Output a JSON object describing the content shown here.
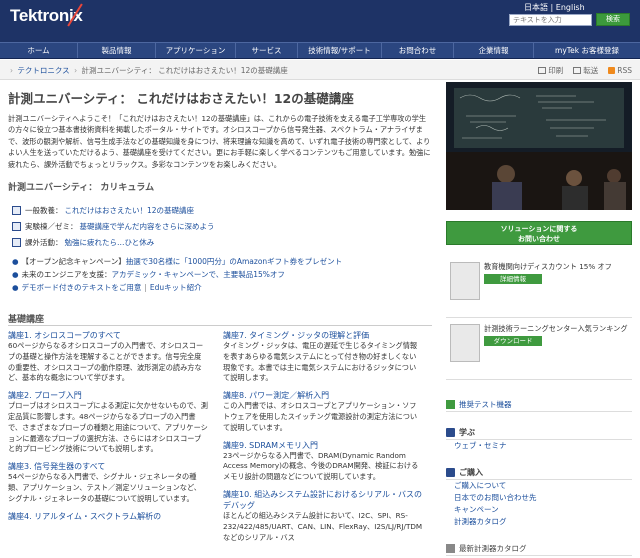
{
  "header": {
    "brand": "Tektronix",
    "language": "日本語 | English",
    "search_placeholder": "テキストを入力",
    "search_button": "検索"
  },
  "nav": [
    {
      "label": "ホーム",
      "width": 0
    },
    {
      "label": "製品情報"
    },
    {
      "label": "アプリケーション"
    },
    {
      "label": "サービス"
    },
    {
      "label": "技術情報/サポート"
    },
    {
      "label": "お問合わせ"
    },
    {
      "label": "企業情報"
    },
    {
      "label": "myTek お客様登録"
    }
  ],
  "breadcrumb": {
    "items": [
      "テクトロニクス",
      "計測ユニバーシティ： これだけはおさえたい！12の基礎講座"
    ],
    "print": "印刷",
    "send": "転送",
    "rss": "RSS"
  },
  "main": {
    "title": "計測ユニバーシティ： これだけはおさえたい！12の基礎講座",
    "intro": "計測ユニバーシティへようこそ！「これだけはおさえたい！12の基礎講座」は、これからの電子技術を支える電子工学専攻の学生の方々に役立つ基本書技術資料を掲載したポータル・サイトです。オシロスコープから信号発生器、スペクトラム・アナライザまで、波形の観測や解析、信号生成手法などの基礎知識を身につけ、将来理論な知識を高めて、いずれ電子技術の専門家として、よりよい人生を送っていただけるよう、基礎講座を受けてください。更にお手軽に楽しく学べるコンテンツもご用意しています。勉強に疲れたら、課外活動でちょっとリラックス。多彩なコンテンツをお楽しみください。",
    "curriculum_heading": "計測ユニバーシティ： カリキュラム",
    "curriculum": [
      {
        "label": "一般教養：",
        "link": "これだけはおさえたい！12の基礎講座"
      },
      {
        "label": "実験棟／ゼミ：",
        "link": "基礎講座で学んだ内容をさらに深めよう"
      },
      {
        "label": "課外活動：",
        "link": "勉強に疲れたら…ひと休み"
      }
    ],
    "promo_lines": [
      {
        "text": "【オープン記念キャンペーン】",
        "link": "抽選で30名様に「1000円分」のAmazonギフト券をプレゼント"
      },
      {
        "text": "未来のエンジニアを支援：",
        "link": "アカデミック・キャンペーンで、主要製品15%オフ"
      },
      {
        "links": [
          "デモボード付きのテキストをご用意",
          "Eduキット紹介"
        ]
      }
    ],
    "basic_heading": "基礎講座",
    "lectures_left": [
      {
        "title": "講座1. オシロスコープのすべて",
        "desc": "60ページからなるオシロスコープの入門書で、オシロスコープの基礎と操作方法を理解することができます。信号完全度の重要性、オシロスコープの動作原理、波形測定の読み方など、基本的な概念について学びます。"
      },
      {
        "title": "講座2. プローブ入門",
        "desc": "プローブはオシロスコープによる測定に欠かせないもので、測定品質に影響します。48ページからなるプローブの入門書で、さまざまなプローブの種類と用途について、アプリケーションに最適なプローブの選択方法、さらにはオシロスコープと的プロービング技術についても説明します。"
      },
      {
        "title": "講座3. 信号発生器のすべて",
        "desc": "54ページからなる入門書で、シグナル・ジェネレータの種類、アプリケーション、テスト／測定ソリューションなど、シグナル・ジェネレータの基礎について説明しています。"
      },
      {
        "title": "講座4. リアルタイム・スペクトラム解析の",
        "desc": ""
      }
    ],
    "lectures_right": [
      {
        "title": "講座7. タイミング・ジッタの理解と評価",
        "desc": "タイミング・ジッタは、電圧の遅延で生じるタイミング情報を表すあらゆる電気システムにとって付き物の好ましくない現象です。本書では主に電気システムにおけるジッタについて説明します。"
      },
      {
        "title": "講座8. パワー測定／解析入門",
        "desc": "この入門書では、オシロスコープとアプリケーション・ソフトウェアを使用したスイッチング電源設計の測定方法について説明しています。"
      },
      {
        "title": "講座9. SDRAMメモリ入門",
        "desc": "23ページからなる入門書で、DRAM(Dynamic Random Access Memory)の概念、今後のDRAM開発、検証におけるメモリ設計の問題などについて説明しています。"
      },
      {
        "title": "講座10. 組込みシステム設計におけるシリアル・バスのデバッグ",
        "desc": "ほとんどの組込みシステム設計において、I2C、SPI、RS-232/422/485/UART、CAN、LIN、FlexRay、I2S/LJ/RJ/TDMなどのシリアル・バス"
      }
    ]
  },
  "sidebar": {
    "cta": "ソリューションに関する\nお問い合わせ",
    "promos": [
      {
        "text": "教育機関向けディスカウント 15% オフ",
        "button": "詳細情報"
      },
      {
        "text": "計測技術ラーニングセンター入気ランキング",
        "button": "ダウンロード"
      }
    ],
    "recommended": "推奨テスト機器",
    "learn_heading": "学ぶ",
    "learn_links": [
      "ウェブ・セミナ"
    ],
    "buy_heading": "ご購入",
    "buy_links": [
      "ご購入について",
      "日本でのお問い合わせ先",
      "キャンペーン",
      "計測器カタログ"
    ],
    "bottom": "最新計測器カタログ"
  },
  "colors": {
    "header_bg": "#1e3366",
    "nav_bg": "#2b4680",
    "link": "#1c4f9c",
    "accent_green": "#3f9a3f"
  }
}
